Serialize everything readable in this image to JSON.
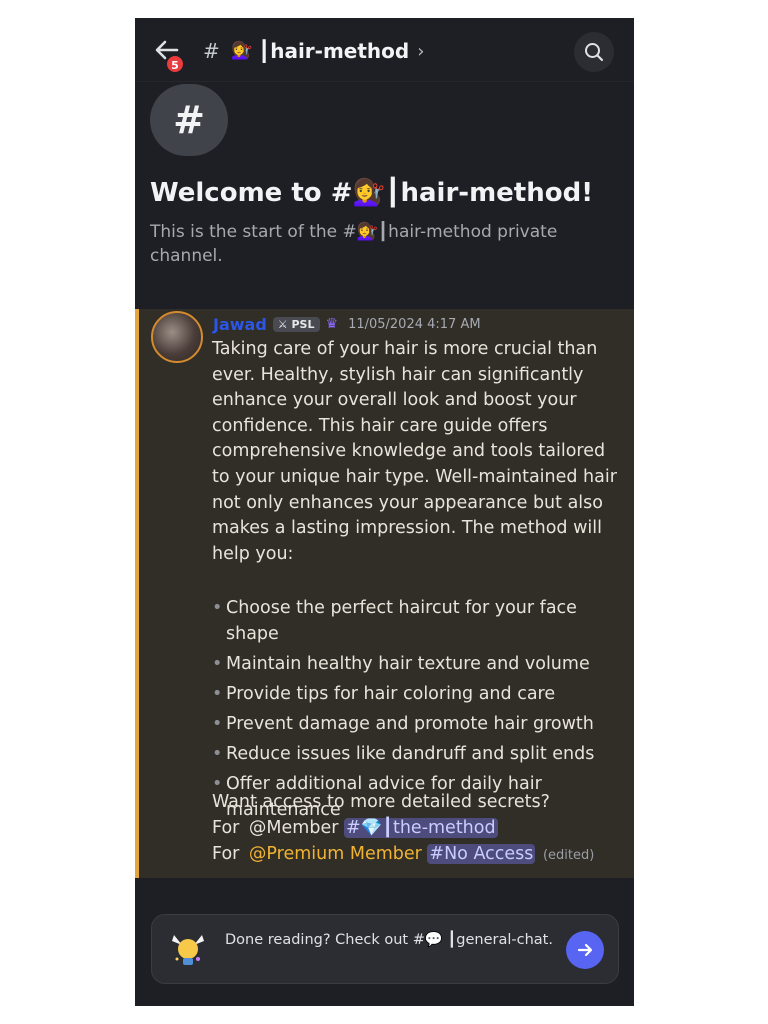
{
  "header": {
    "unread_badge": "5",
    "channel_hash": "#",
    "channel_emoji": "💇‍♀️",
    "channel_name": "┃hair-method",
    "chevron": "›"
  },
  "welcome": {
    "icon_glyph": "#",
    "title": "Welcome to #💇‍♀️┃hair-method!",
    "subtitle": "This is the start of the #💇‍♀️┃hair-method private channel."
  },
  "message": {
    "author": "Jawad",
    "tag": "PSL",
    "timestamp": "11/05/2024 4:17 AM",
    "intro": "Taking care of your hair is more crucial than ever. Healthy, stylish hair can significantly enhance your overall look and boost your confidence. This hair care guide offers comprehensive knowledge and tools tailored to your unique hair type. Well-maintained hair not only enhances your appearance but also makes a lasting impression. The method will help you:",
    "bullets": [
      "Choose the perfect haircut for your face shape",
      "Maintain healthy hair texture and volume",
      "Provide tips for hair coloring and care",
      "Prevent damage and promote hair growth",
      "Reduce issues like dandruff and split ends",
      "Offer additional advice for daily hair maintenance"
    ],
    "access_question": "Want access to more detailed secrets?",
    "for_label": "For",
    "member_mention": "@Member",
    "member_channel": "#💎┃the-method",
    "premium_mention": "@Premium Member",
    "premium_channel": "#No Access",
    "edited": "(edited)"
  },
  "bottom_prompt": {
    "text": "Done reading? Check out #💬 ┃general-chat."
  },
  "colors": {
    "background": "#1e1f24",
    "message_highlight": "#312d27",
    "highlight_border": "#e3a63b",
    "author": "#2b56e8",
    "premium": "#f0b432",
    "channel_pill": "#4e4b7d",
    "send_button": "#5865f2",
    "badge": "#e83c3e"
  },
  "icons": {
    "back": "arrow-left-icon",
    "search": "search-icon",
    "go": "arrow-right-icon",
    "mascot": "lightbulb-icon"
  }
}
